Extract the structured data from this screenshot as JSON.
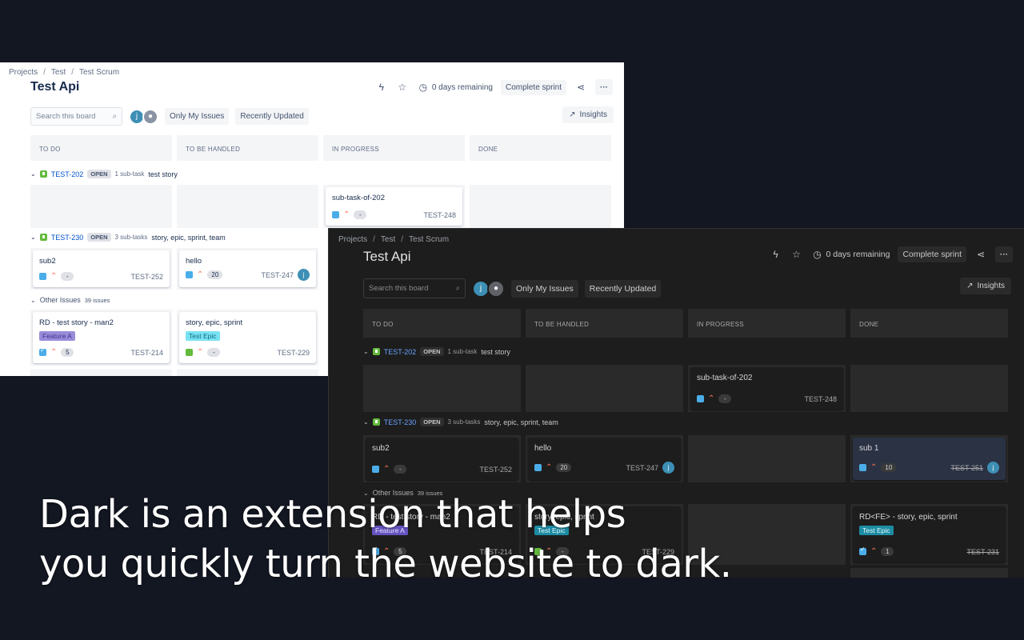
{
  "breadcrumbs": [
    "Projects",
    "Test",
    "Test Scrum"
  ],
  "breadcrumb_sep": "/",
  "board_title": "Test Api",
  "header": {
    "remaining": "0 days remaining",
    "complete_sprint": "Complete sprint"
  },
  "toolbar": {
    "search_placeholder": "Search this board",
    "avatar_initial": "j",
    "only_my_issues": "Only My Issues",
    "recently_updated": "Recently Updated",
    "insights": "Insights"
  },
  "columns": [
    "TO DO",
    "TO BE HANDLED",
    "IN PROGRESS",
    "DONE"
  ],
  "swimlanes": [
    {
      "key": "TEST-202",
      "status": "OPEN",
      "subtasks": "1 sub-task",
      "summary": "test story"
    },
    {
      "key": "TEST-230",
      "status": "OPEN",
      "subtasks": "3 sub-tasks",
      "summary": "story, epic, sprint, team"
    }
  ],
  "other_issues": {
    "label": "Other Issues",
    "count": "39 issues"
  },
  "cards": {
    "c248": {
      "summary": "sub-task-of-202",
      "estimate": "-",
      "key": "TEST-248"
    },
    "c252": {
      "summary": "sub2",
      "estimate": "-",
      "key": "TEST-252"
    },
    "c247": {
      "summary": "hello",
      "estimate": "20",
      "key": "TEST-247",
      "assignee": "j"
    },
    "c251": {
      "summary": "sub 1",
      "estimate": "10",
      "key": "TEST-251",
      "assignee": "j"
    },
    "c214": {
      "summary": "RD - test story - man2",
      "epic": "Feature A",
      "estimate": "5",
      "key": "TEST-214"
    },
    "c229": {
      "summary": "story, epic, sprint",
      "epic": "Test Epic",
      "estimate": "-",
      "key": "TEST-229"
    },
    "c231": {
      "summary": "RD<FE> - story, epic, sprint",
      "epic": "Test Epic",
      "estimate": "1",
      "key": "TEST-231"
    }
  },
  "caption": {
    "line1": "Dark is an extension that helps",
    "line2": "you quickly turn the website to dark."
  },
  "colors": {
    "background": "#131722",
    "light_panel": "#ffffff",
    "dark_panel": "#1d1d1d",
    "link_blue": "#0052cc",
    "priority_orange": "#ff7452",
    "story_green": "#63ba3c"
  }
}
